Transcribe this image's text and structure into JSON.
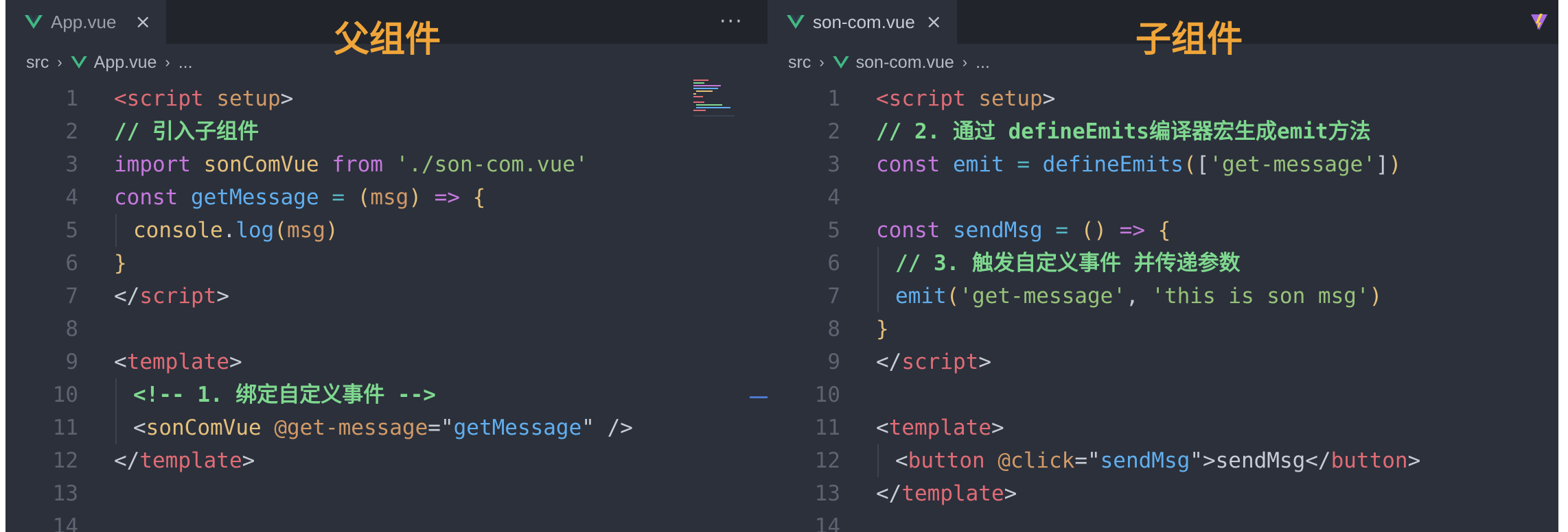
{
  "left": {
    "tab": {
      "label": "App.vue",
      "icon": "vue-icon",
      "close": "×"
    },
    "more": "···",
    "heading": "父组件",
    "breadcrumb": {
      "root": "src",
      "file": "App.vue",
      "tail": "..."
    },
    "lines": [
      {
        "n": "1",
        "indent": false,
        "tokens": [
          [
            "tag",
            "<"
          ],
          [
            "tag",
            "script"
          ],
          [
            "p",
            " "
          ],
          [
            "attr",
            "setup"
          ],
          [
            "p",
            ">"
          ]
        ]
      },
      {
        "n": "2",
        "indent": false,
        "tokens": [
          [
            "cm",
            "// 引入子组件"
          ]
        ]
      },
      {
        "n": "3",
        "indent": false,
        "tokens": [
          [
            "kw",
            "import"
          ],
          [
            "p",
            " "
          ],
          [
            "var",
            "sonComVue"
          ],
          [
            "p",
            " "
          ],
          [
            "kw",
            "from"
          ],
          [
            "p",
            " "
          ],
          [
            "str",
            "'./son-com.vue'"
          ]
        ]
      },
      {
        "n": "4",
        "indent": false,
        "tokens": [
          [
            "kw",
            "const"
          ],
          [
            "p",
            " "
          ],
          [
            "fn",
            "getMessage"
          ],
          [
            "p",
            " "
          ],
          [
            "op",
            "="
          ],
          [
            "p",
            " "
          ],
          [
            "br",
            "("
          ],
          [
            "attr",
            "msg"
          ],
          [
            "br",
            ")"
          ],
          [
            "p",
            " "
          ],
          [
            "kw",
            "=>"
          ],
          [
            "p",
            " "
          ],
          [
            "br",
            "{"
          ]
        ]
      },
      {
        "n": "5",
        "indent": true,
        "tokens": [
          [
            "var",
            "console"
          ],
          [
            "p",
            "."
          ],
          [
            "fn",
            "log"
          ],
          [
            "br",
            "("
          ],
          [
            "attr",
            "msg"
          ],
          [
            "br",
            ")"
          ]
        ]
      },
      {
        "n": "6",
        "indent": false,
        "tokens": [
          [
            "br",
            "}"
          ]
        ]
      },
      {
        "n": "7",
        "indent": false,
        "tokens": [
          [
            "p",
            "</"
          ],
          [
            "tag",
            "script"
          ],
          [
            "p",
            ">"
          ]
        ]
      },
      {
        "n": "8",
        "indent": false,
        "tokens": []
      },
      {
        "n": "9",
        "indent": false,
        "tokens": [
          [
            "p",
            "<"
          ],
          [
            "tag",
            "template"
          ],
          [
            "p",
            ">"
          ]
        ]
      },
      {
        "n": "10",
        "indent": true,
        "tokens": [
          [
            "cm",
            "<!-- 1. 绑定自定义事件 -->"
          ]
        ]
      },
      {
        "n": "11",
        "indent": true,
        "tokens": [
          [
            "p",
            "<"
          ],
          [
            "var",
            "sonComVue"
          ],
          [
            "p",
            " "
          ],
          [
            "attr",
            "@get-message"
          ],
          [
            "p",
            "=\""
          ],
          [
            "fn",
            "getMessage"
          ],
          [
            "p",
            "\" />"
          ]
        ]
      },
      {
        "n": "12",
        "indent": false,
        "tokens": [
          [
            "p",
            "</"
          ],
          [
            "tag",
            "template"
          ],
          [
            "p",
            ">"
          ]
        ]
      },
      {
        "n": "13",
        "indent": false,
        "tokens": []
      },
      {
        "n": "14",
        "indent": false,
        "tokens": []
      }
    ]
  },
  "right": {
    "tab": {
      "label": "son-com.vue",
      "icon": "vue-icon",
      "close": "×"
    },
    "heading": "子组件",
    "breadcrumb": {
      "root": "src",
      "file": "son-com.vue",
      "tail": "..."
    },
    "lines": [
      {
        "n": "1",
        "indent": false,
        "tokens": [
          [
            "tag",
            "<"
          ],
          [
            "tag",
            "script"
          ],
          [
            "p",
            " "
          ],
          [
            "attr",
            "setup"
          ],
          [
            "p",
            ">"
          ]
        ]
      },
      {
        "n": "2",
        "indent": false,
        "tokens": [
          [
            "cm",
            "// 2. 通过 defineEmits编译器宏生成emit方法"
          ]
        ]
      },
      {
        "n": "3",
        "indent": false,
        "tokens": [
          [
            "kw",
            "const"
          ],
          [
            "p",
            " "
          ],
          [
            "fn",
            "emit"
          ],
          [
            "p",
            " "
          ],
          [
            "op",
            "="
          ],
          [
            "p",
            " "
          ],
          [
            "fn",
            "defineEmits"
          ],
          [
            "br",
            "("
          ],
          [
            "p",
            "["
          ],
          [
            "str",
            "'get-message'"
          ],
          [
            "p",
            "]"
          ],
          [
            "br",
            ")"
          ]
        ]
      },
      {
        "n": "4",
        "indent": false,
        "tokens": []
      },
      {
        "n": "5",
        "indent": false,
        "tokens": [
          [
            "kw",
            "const"
          ],
          [
            "p",
            " "
          ],
          [
            "fn",
            "sendMsg"
          ],
          [
            "p",
            " "
          ],
          [
            "op",
            "="
          ],
          [
            "p",
            " "
          ],
          [
            "br",
            "()"
          ],
          [
            "p",
            " "
          ],
          [
            "kw",
            "=>"
          ],
          [
            "p",
            " "
          ],
          [
            "br",
            "{"
          ]
        ]
      },
      {
        "n": "6",
        "indent": true,
        "tokens": [
          [
            "cm",
            "// 3. 触发自定义事件 并传递参数"
          ]
        ]
      },
      {
        "n": "7",
        "indent": true,
        "tokens": [
          [
            "fn",
            "emit"
          ],
          [
            "br",
            "("
          ],
          [
            "str",
            "'get-message'"
          ],
          [
            "p",
            ", "
          ],
          [
            "str",
            "'this is son msg'"
          ],
          [
            "br",
            ")"
          ]
        ]
      },
      {
        "n": "8",
        "indent": false,
        "tokens": [
          [
            "br",
            "}"
          ]
        ]
      },
      {
        "n": "9",
        "indent": false,
        "tokens": [
          [
            "p",
            "</"
          ],
          [
            "tag",
            "script"
          ],
          [
            "p",
            ">"
          ]
        ]
      },
      {
        "n": "10",
        "indent": false,
        "tokens": []
      },
      {
        "n": "11",
        "indent": false,
        "tokens": [
          [
            "p",
            "<"
          ],
          [
            "tag",
            "template"
          ],
          [
            "p",
            ">"
          ]
        ]
      },
      {
        "n": "12",
        "indent": true,
        "tokens": [
          [
            "p",
            "<"
          ],
          [
            "tag",
            "button"
          ],
          [
            "p",
            " "
          ],
          [
            "attr",
            "@click"
          ],
          [
            "p",
            "=\""
          ],
          [
            "fn",
            "sendMsg"
          ],
          [
            "p",
            "\">sendMsg</"
          ],
          [
            "tag",
            "button"
          ],
          [
            "p",
            ">"
          ]
        ]
      },
      {
        "n": "13",
        "indent": false,
        "tokens": [
          [
            "p",
            "</"
          ],
          [
            "tag",
            "template"
          ],
          [
            "p",
            ">"
          ]
        ]
      },
      {
        "n": "14",
        "indent": false,
        "tokens": []
      }
    ]
  },
  "colors": {
    "background": "#2b303b",
    "heading": "#f0a53a",
    "keyword": "#c678dd",
    "tag": "#e06c75",
    "function": "#61afef",
    "string": "#98c379",
    "comment": "#7fd88f"
  }
}
